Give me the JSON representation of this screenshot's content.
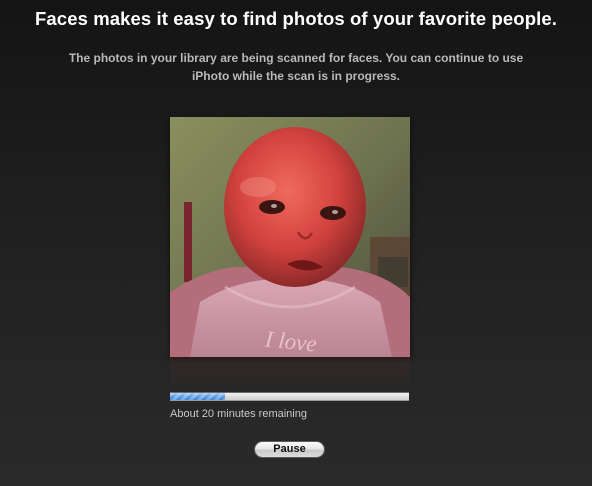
{
  "headline": "Faces makes it easy to find photos of your favorite people.",
  "description": "The photos in your library are being scanned for faces. You can continue to use iPhoto while the scan is in progress.",
  "photo": {
    "shirt_text": "I love"
  },
  "progress": {
    "fraction": 0.23,
    "fill_color": "#5f9ee6",
    "status": "About 20 minutes remaining"
  },
  "pause_button": {
    "label": "Pause"
  }
}
